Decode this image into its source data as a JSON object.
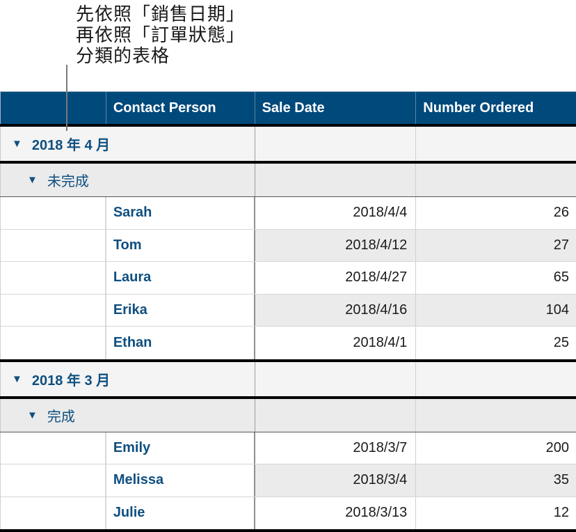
{
  "callout": {
    "lines": [
      "先依照「銷售日期」",
      "再依照「訂單狀態」",
      "分類的表格"
    ]
  },
  "table": {
    "headers": [
      "",
      "Contact Person",
      "Sale Date",
      "Number Ordered"
    ],
    "colors": {
      "header_bg": "#00497b",
      "group_text": "#0e4f80",
      "group_bg": "#f4f4f4",
      "subgroup_bg": "#ebebeb"
    },
    "groups": [
      {
        "label": "2018 年 4 月",
        "collapse_icon": "triangle-down-icon",
        "subgroups": [
          {
            "label": "未完成",
            "collapse_icon": "triangle-down-icon",
            "rows": [
              {
                "contact": "Sarah",
                "date": "2018/4/4",
                "ordered": "26"
              },
              {
                "contact": "Tom",
                "date": "2018/4/12",
                "ordered": "27"
              },
              {
                "contact": "Laura",
                "date": "2018/4/27",
                "ordered": "65"
              },
              {
                "contact": "Erika",
                "date": "2018/4/16",
                "ordered": "104"
              },
              {
                "contact": "Ethan",
                "date": "2018/4/1",
                "ordered": "25"
              }
            ]
          }
        ]
      },
      {
        "label": "2018 年 3 月",
        "collapse_icon": "triangle-down-icon",
        "subgroups": [
          {
            "label": "完成",
            "collapse_icon": "triangle-down-icon",
            "rows": [
              {
                "contact": "Emily",
                "date": "2018/3/7",
                "ordered": "200"
              },
              {
                "contact": "Melissa",
                "date": "2018/3/4",
                "ordered": "35"
              },
              {
                "contact": "Julie",
                "date": "2018/3/13",
                "ordered": "12"
              }
            ]
          }
        ]
      }
    ]
  }
}
